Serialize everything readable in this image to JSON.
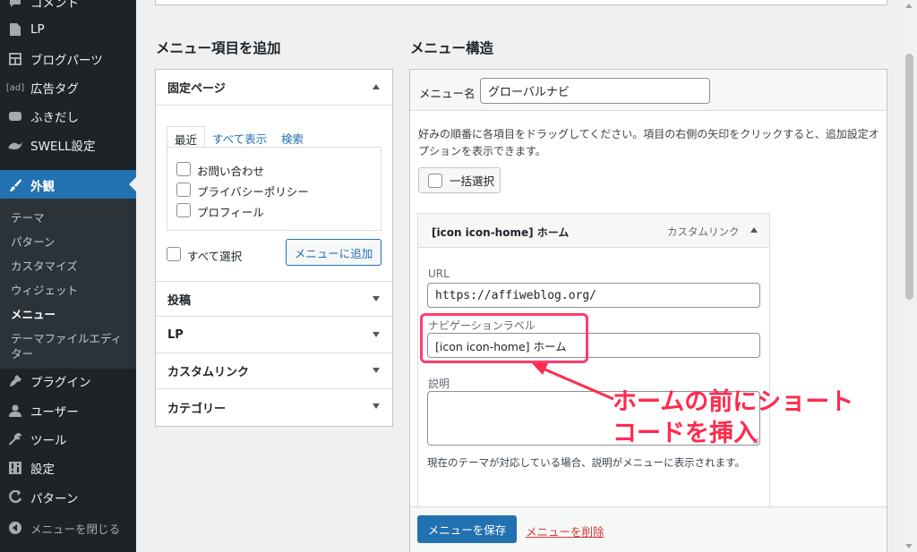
{
  "sidebar": {
    "items": [
      {
        "label": "コメント",
        "icon": "comment-icon"
      },
      {
        "label": "LP",
        "icon": "page-icon"
      },
      {
        "label": "ブログパーツ",
        "icon": "layout-icon"
      },
      {
        "label": "広告タグ",
        "icon": "ad-icon",
        "icon_text": "[ad]"
      },
      {
        "label": "ふきだし",
        "icon": "speech-bubble-icon"
      },
      {
        "label": "SWELL設定",
        "icon": "swell-icon"
      },
      {
        "label": "外観",
        "icon": "brush-icon",
        "active": true
      },
      {
        "label": "プラグイン",
        "icon": "plugin-icon"
      },
      {
        "label": "ユーザー",
        "icon": "user-icon"
      },
      {
        "label": "ツール",
        "icon": "wrench-icon"
      },
      {
        "label": "設定",
        "icon": "settings-icon"
      },
      {
        "label": "パターン",
        "icon": "pattern-icon"
      },
      {
        "label": "メニューを閉じる",
        "icon": "collapse-icon"
      }
    ],
    "submenu": [
      {
        "label": "テーマ"
      },
      {
        "label": "パターン"
      },
      {
        "label": "カスタマイズ"
      },
      {
        "label": "ウィジェット"
      },
      {
        "label": "メニュー",
        "current": true
      },
      {
        "label": "テーマファイルエディ"
      },
      {
        "label": "ター"
      }
    ]
  },
  "add_items": {
    "title": "メニュー項目を追加",
    "fixed_pages": {
      "header": "固定ページ",
      "tabs": [
        "最近",
        "すべて表示",
        "検索"
      ],
      "pages": [
        "お問い合わせ",
        "プライバシーポリシー",
        "プロフィール"
      ],
      "select_all": "すべて選択",
      "add_button": "メニューに追加"
    },
    "sections": [
      "投稿",
      "LP",
      "カスタムリンク",
      "カテゴリー"
    ]
  },
  "structure": {
    "title": "メニュー構造",
    "menu_name_label": "メニュー名",
    "menu_name_value": "グローバルナビ",
    "instructions": "好みの順番に各項目をドラッグしてください。項目の右側の矢印をクリックすると、追加設定オプションを表示できます。",
    "bulk_select": "一括選択",
    "item": {
      "title": "[icon icon-home] ホーム",
      "type": "カスタムリンク",
      "url_label": "URL",
      "url_value": "https://affiweblog.org/",
      "nav_label": "ナビゲーションラベル",
      "nav_value": "[icon icon-home] ホーム",
      "desc_label": "説明",
      "desc_value": "",
      "desc_note": "現在のテーマが対応している場合、説明がメニューに表示されます。"
    },
    "save_button": "メニューを保存",
    "delete_link": "メニューを削除"
  },
  "annotation": {
    "line1": "ホームの前にショート",
    "line2": "コードを挿入",
    "color": "#ff2a4d"
  }
}
